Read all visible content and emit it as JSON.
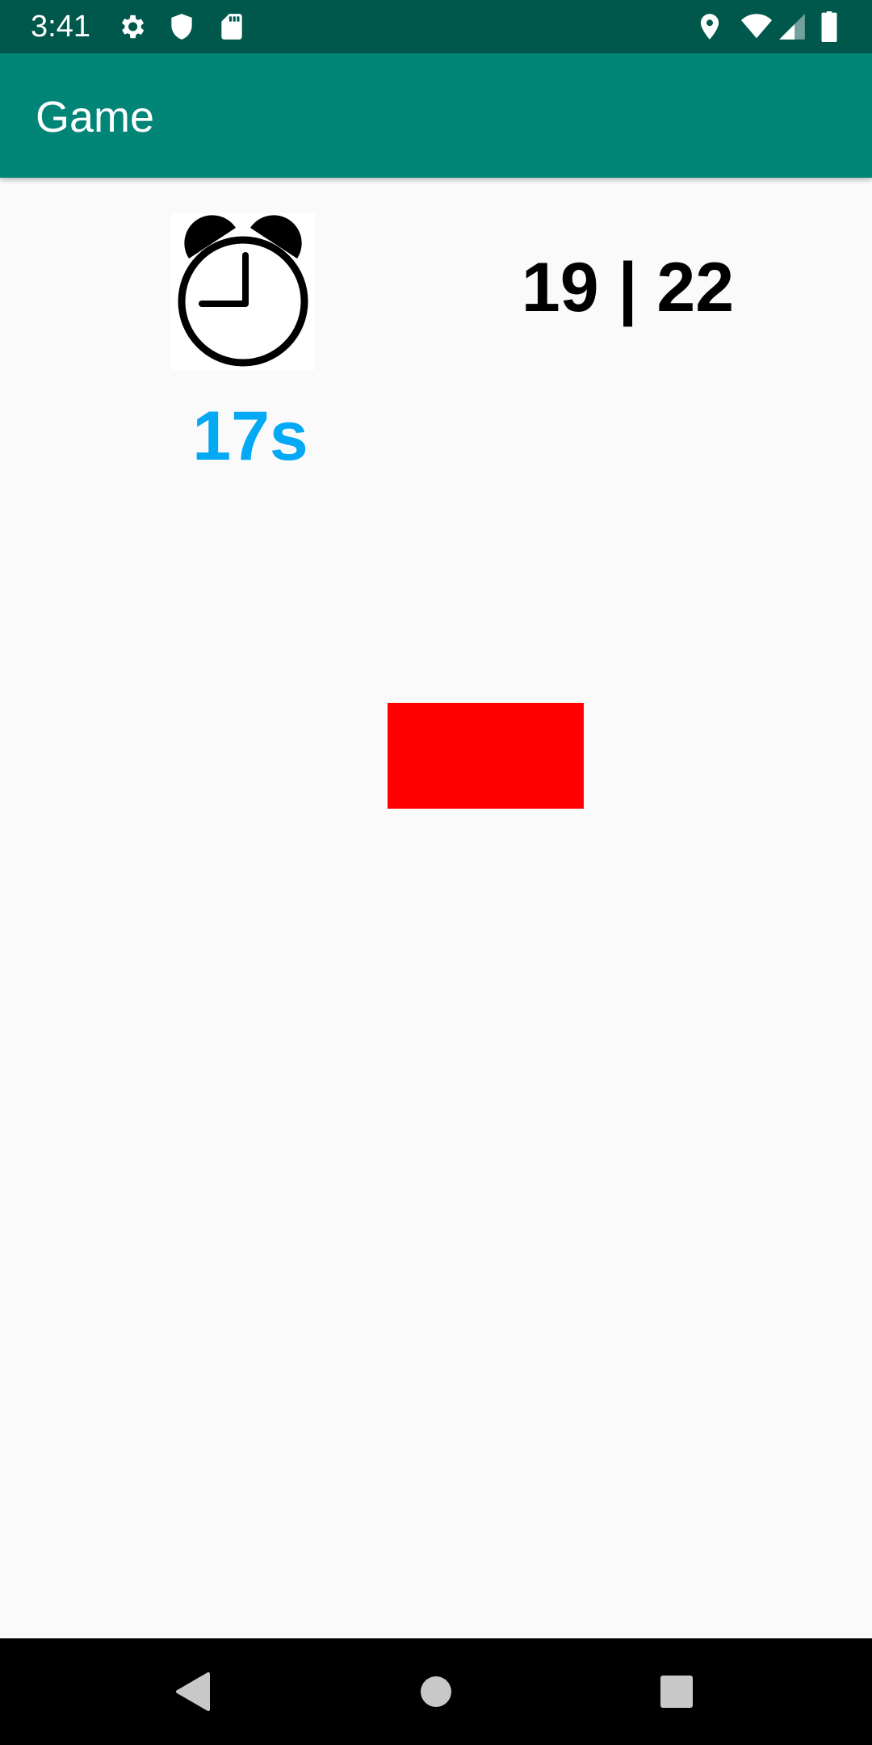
{
  "status_bar": {
    "time": "3:41",
    "left_icons": [
      "gear-icon",
      "shield-icon",
      "sd-card-icon"
    ],
    "right_icons": [
      "location-icon",
      "wifi-icon",
      "signal-icon",
      "battery-icon"
    ]
  },
  "app_bar": {
    "title": "Game"
  },
  "game": {
    "clock_icon": "alarm-clock-icon",
    "timer": "17s",
    "score": "19 | 22",
    "target_color": "#ff0000",
    "timer_color": "#03a9f4"
  },
  "nav_bar": {
    "buttons": [
      "back-icon",
      "home-icon",
      "recents-icon"
    ]
  },
  "colors": {
    "status_bar": "#00574b",
    "app_bar": "#008577",
    "background": "#fafafa"
  }
}
